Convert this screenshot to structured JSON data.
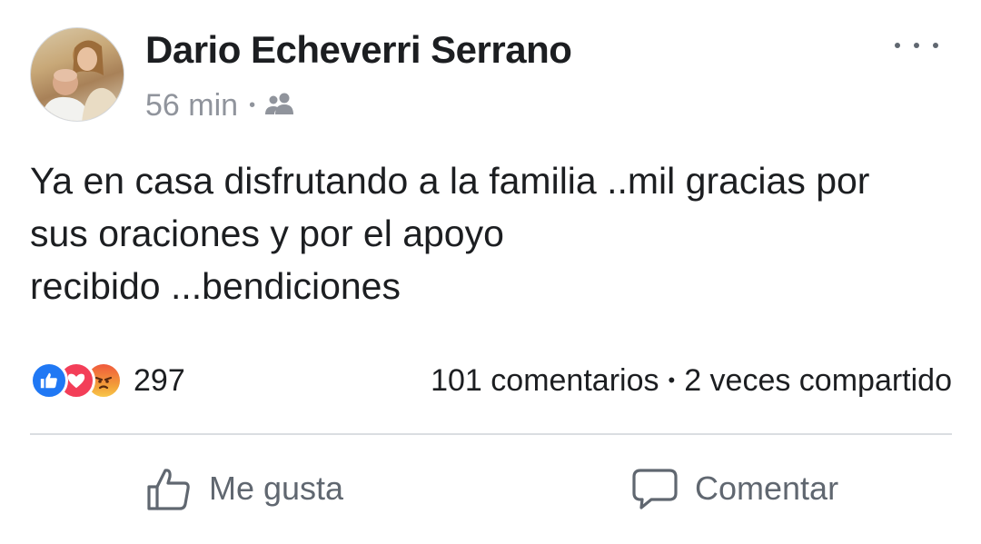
{
  "post": {
    "author": "Dario Echeverri Serrano",
    "time": "56 min",
    "separator": "•",
    "audience_icon": "friends-icon",
    "text": "Ya en casa disfrutando a la familia ..mil gracias por\nsus oraciones y por el apoyo\nrecibido ...bendiciones"
  },
  "stats": {
    "reactions": [
      "like-reaction-icon",
      "love-reaction-icon",
      "angry-reaction-icon"
    ],
    "reaction_count": "297",
    "comments": "101 comentarios",
    "separator": "•",
    "shares": "2 veces compartido"
  },
  "actions": {
    "like_label": "Me gusta",
    "comment_label": "Comentar"
  },
  "colors": {
    "like_blue": "#2078f4",
    "love_red": "#f33e58",
    "angry_orange": "#f05a3c",
    "meta_gray": "#90949c",
    "action_gray": "#606770"
  }
}
